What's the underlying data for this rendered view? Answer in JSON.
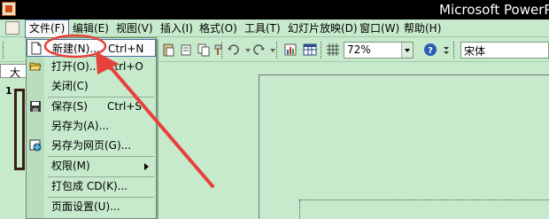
{
  "window": {
    "title": "Microsoft PowerPoi"
  },
  "menubar": {
    "items": [
      {
        "label": "文件(F)"
      },
      {
        "label": "编辑(E)"
      },
      {
        "label": "视图(V)"
      },
      {
        "label": "插入(I)"
      },
      {
        "label": "格式(O)"
      },
      {
        "label": "工具(T)"
      },
      {
        "label": "幻灯片放映(D)"
      },
      {
        "label": "窗口(W)"
      },
      {
        "label": "帮助(H)"
      }
    ]
  },
  "toolbar": {
    "zoom_value": "72%",
    "font_value": "宋体"
  },
  "outline": {
    "tab_label": "大",
    "slide_number": "1"
  },
  "file_menu": {
    "items": [
      {
        "label": "新建(N)...",
        "shortcut": "Ctrl+N"
      },
      {
        "label": "打开(O)...",
        "shortcut": "Ctrl+O"
      },
      {
        "label": "关闭(C)",
        "shortcut": ""
      },
      {
        "label": "保存(S)",
        "shortcut": "Ctrl+S"
      },
      {
        "label": "另存为(A)...",
        "shortcut": ""
      },
      {
        "label": "另存为网页(G)...",
        "shortcut": ""
      },
      {
        "label": "权限(M)",
        "shortcut": ""
      },
      {
        "label": "打包成 CD(K)...",
        "shortcut": ""
      },
      {
        "label": "页面设置(U)...",
        "shortcut": ""
      }
    ]
  },
  "colors": {
    "annotation": "#e8403a",
    "ui_background": "#c6eacb"
  }
}
